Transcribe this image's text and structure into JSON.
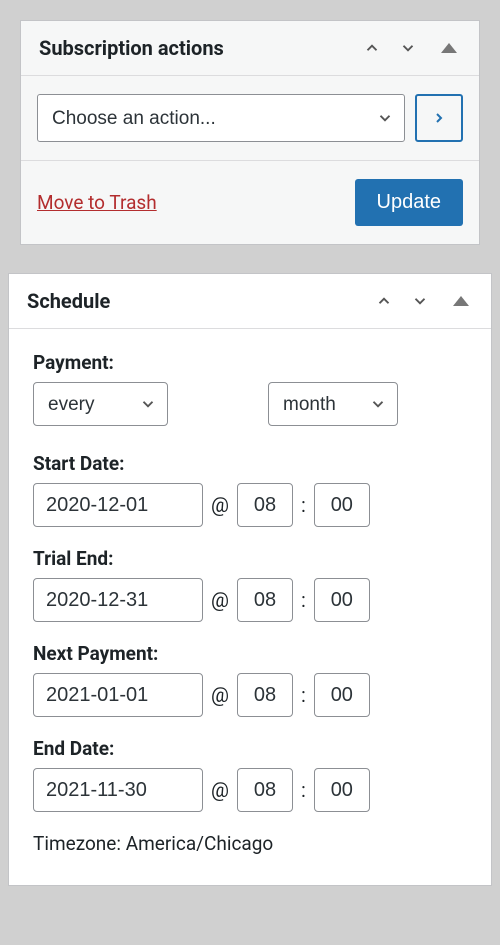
{
  "subscription_actions": {
    "title": "Subscription actions",
    "select_placeholder": "Choose an action...",
    "trash_label": "Move to Trash",
    "update_label": "Update"
  },
  "schedule": {
    "title": "Schedule",
    "payment_label": "Payment:",
    "frequency_every": "every",
    "frequency_unit": "month",
    "start_date_label": "Start Date:",
    "trial_end_label": "Trial End:",
    "next_payment_label": "Next Payment:",
    "end_date_label": "End Date:",
    "at_symbol": "@",
    "colon_symbol": ":",
    "dates": {
      "start": {
        "date": "2020-12-01",
        "hour": "08",
        "minute": "00"
      },
      "trial_end": {
        "date": "2020-12-31",
        "hour": "08",
        "minute": "00"
      },
      "next_payment": {
        "date": "2021-01-01",
        "hour": "08",
        "minute": "00"
      },
      "end": {
        "date": "2021-11-30",
        "hour": "08",
        "minute": "00"
      }
    },
    "timezone_label": "Timezone: America/Chicago"
  }
}
